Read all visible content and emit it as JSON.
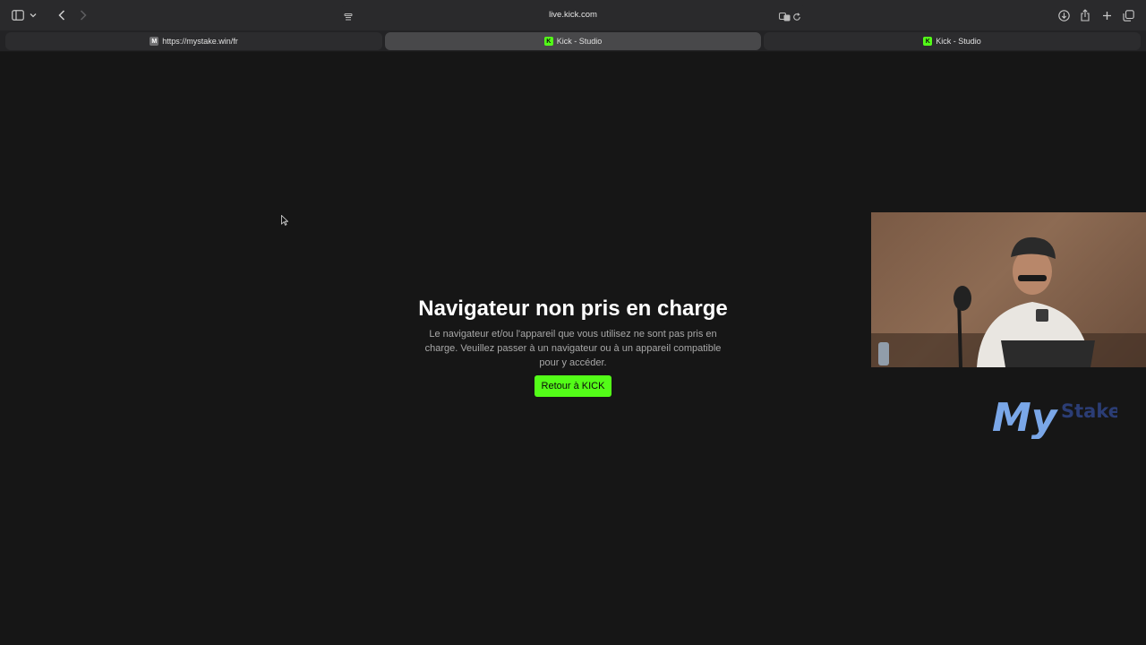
{
  "browser": {
    "address": "live.kick.com",
    "tabs": [
      {
        "label": "https://mystake.win/fr",
        "favicon": "M"
      },
      {
        "label": "Kick - Studio",
        "favicon": "K",
        "active": true
      },
      {
        "label": "Kick - Studio",
        "favicon": "K"
      }
    ],
    "icons": [
      "sidebar-icon",
      "chevron-down-icon",
      "back-icon",
      "forward-icon",
      "page-menu-icon",
      "translate-icon",
      "reload-icon",
      "download-icon",
      "share-icon",
      "new-tab-icon",
      "tab-overview-icon"
    ]
  },
  "page": {
    "title": "Navigateur non pris en charge",
    "description": "Le navigateur et/ou l'appareil que vous utilisez ne sont pas pris en charge. Veuillez passer à un navigateur ou à un appareil compatible pour y accéder.",
    "button_label": "Retour à KICK",
    "accent_color": "#53fc18"
  },
  "overlay": {
    "brand_my": "My",
    "brand_stake": "Stake"
  }
}
